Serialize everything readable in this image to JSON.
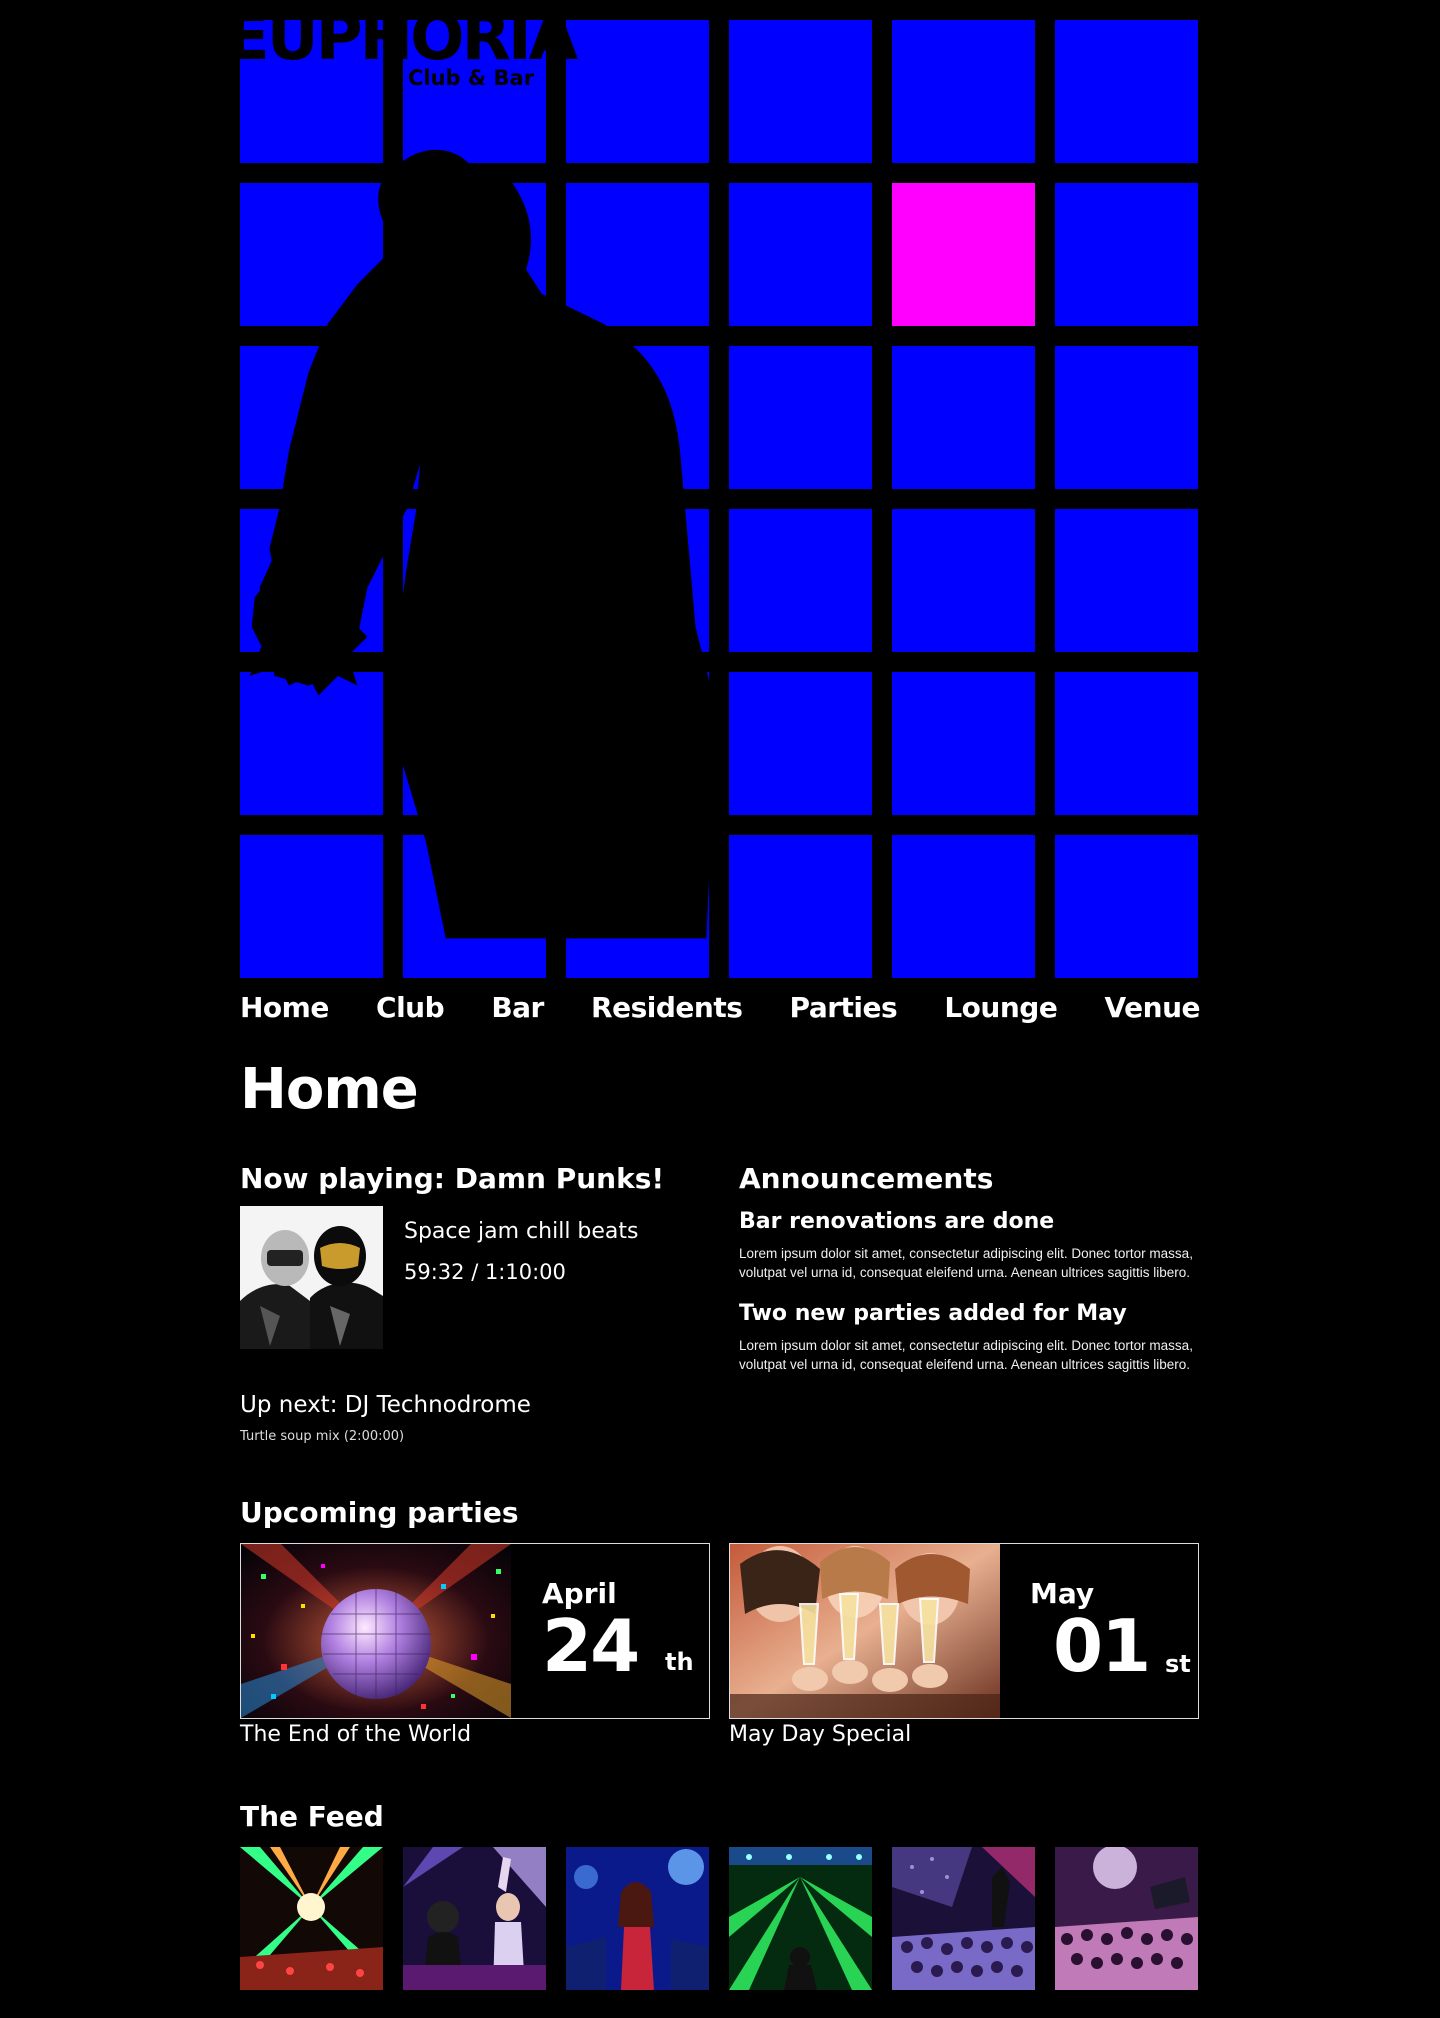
{
  "logo": {
    "title": "EUPHORIA",
    "subtitle": "Club & Bar"
  },
  "colors": {
    "tile": "#0000ff",
    "tile_highlight": "#ff00ff",
    "background": "#000000",
    "text": "#ffffff"
  },
  "nav": [
    "Home",
    "Club",
    "Bar",
    "Residents",
    "Parties",
    "Lounge",
    "Venue"
  ],
  "page_title": "Home",
  "now_playing": {
    "heading": "Now playing: Damn Punks!",
    "track": "Space jam chill beats",
    "time": "59:32 / 1:10:00",
    "up_next": "Up next: DJ Technodrome",
    "up_next_detail": "Turtle soup mix (2:00:00)"
  },
  "announcements": {
    "heading": "Announcements",
    "items": [
      {
        "title": "Bar renovations are done",
        "body": "Lorem ipsum dolor sit amet, consectetur adipiscing elit. Donec tortor massa, volutpat vel urna id, consequat eleifend urna. Aenean ultrices sagittis libero."
      },
      {
        "title": "Two new parties added for May",
        "body": "Lorem ipsum dolor sit amet, consectetur adipiscing elit. Donec tortor massa, volutpat vel urna id, consequat eleifend urna. Aenean ultrices sagittis libero."
      }
    ]
  },
  "upcoming": {
    "heading": "Upcoming parties",
    "parties": [
      {
        "month": "April",
        "day": "24",
        "suffix": "th",
        "name": "The End of the World",
        "image": "disco-ball"
      },
      {
        "month": "May",
        "day": "01",
        "suffix": "st",
        "name": "May Day Special",
        "image": "champagne-toast"
      }
    ]
  },
  "feed": {
    "heading": "The Feed",
    "images": [
      "laser-stage",
      "dj-booth-crowd",
      "dancer-blue",
      "green-lasers",
      "crowd-confetti",
      "crowd-flag"
    ]
  }
}
